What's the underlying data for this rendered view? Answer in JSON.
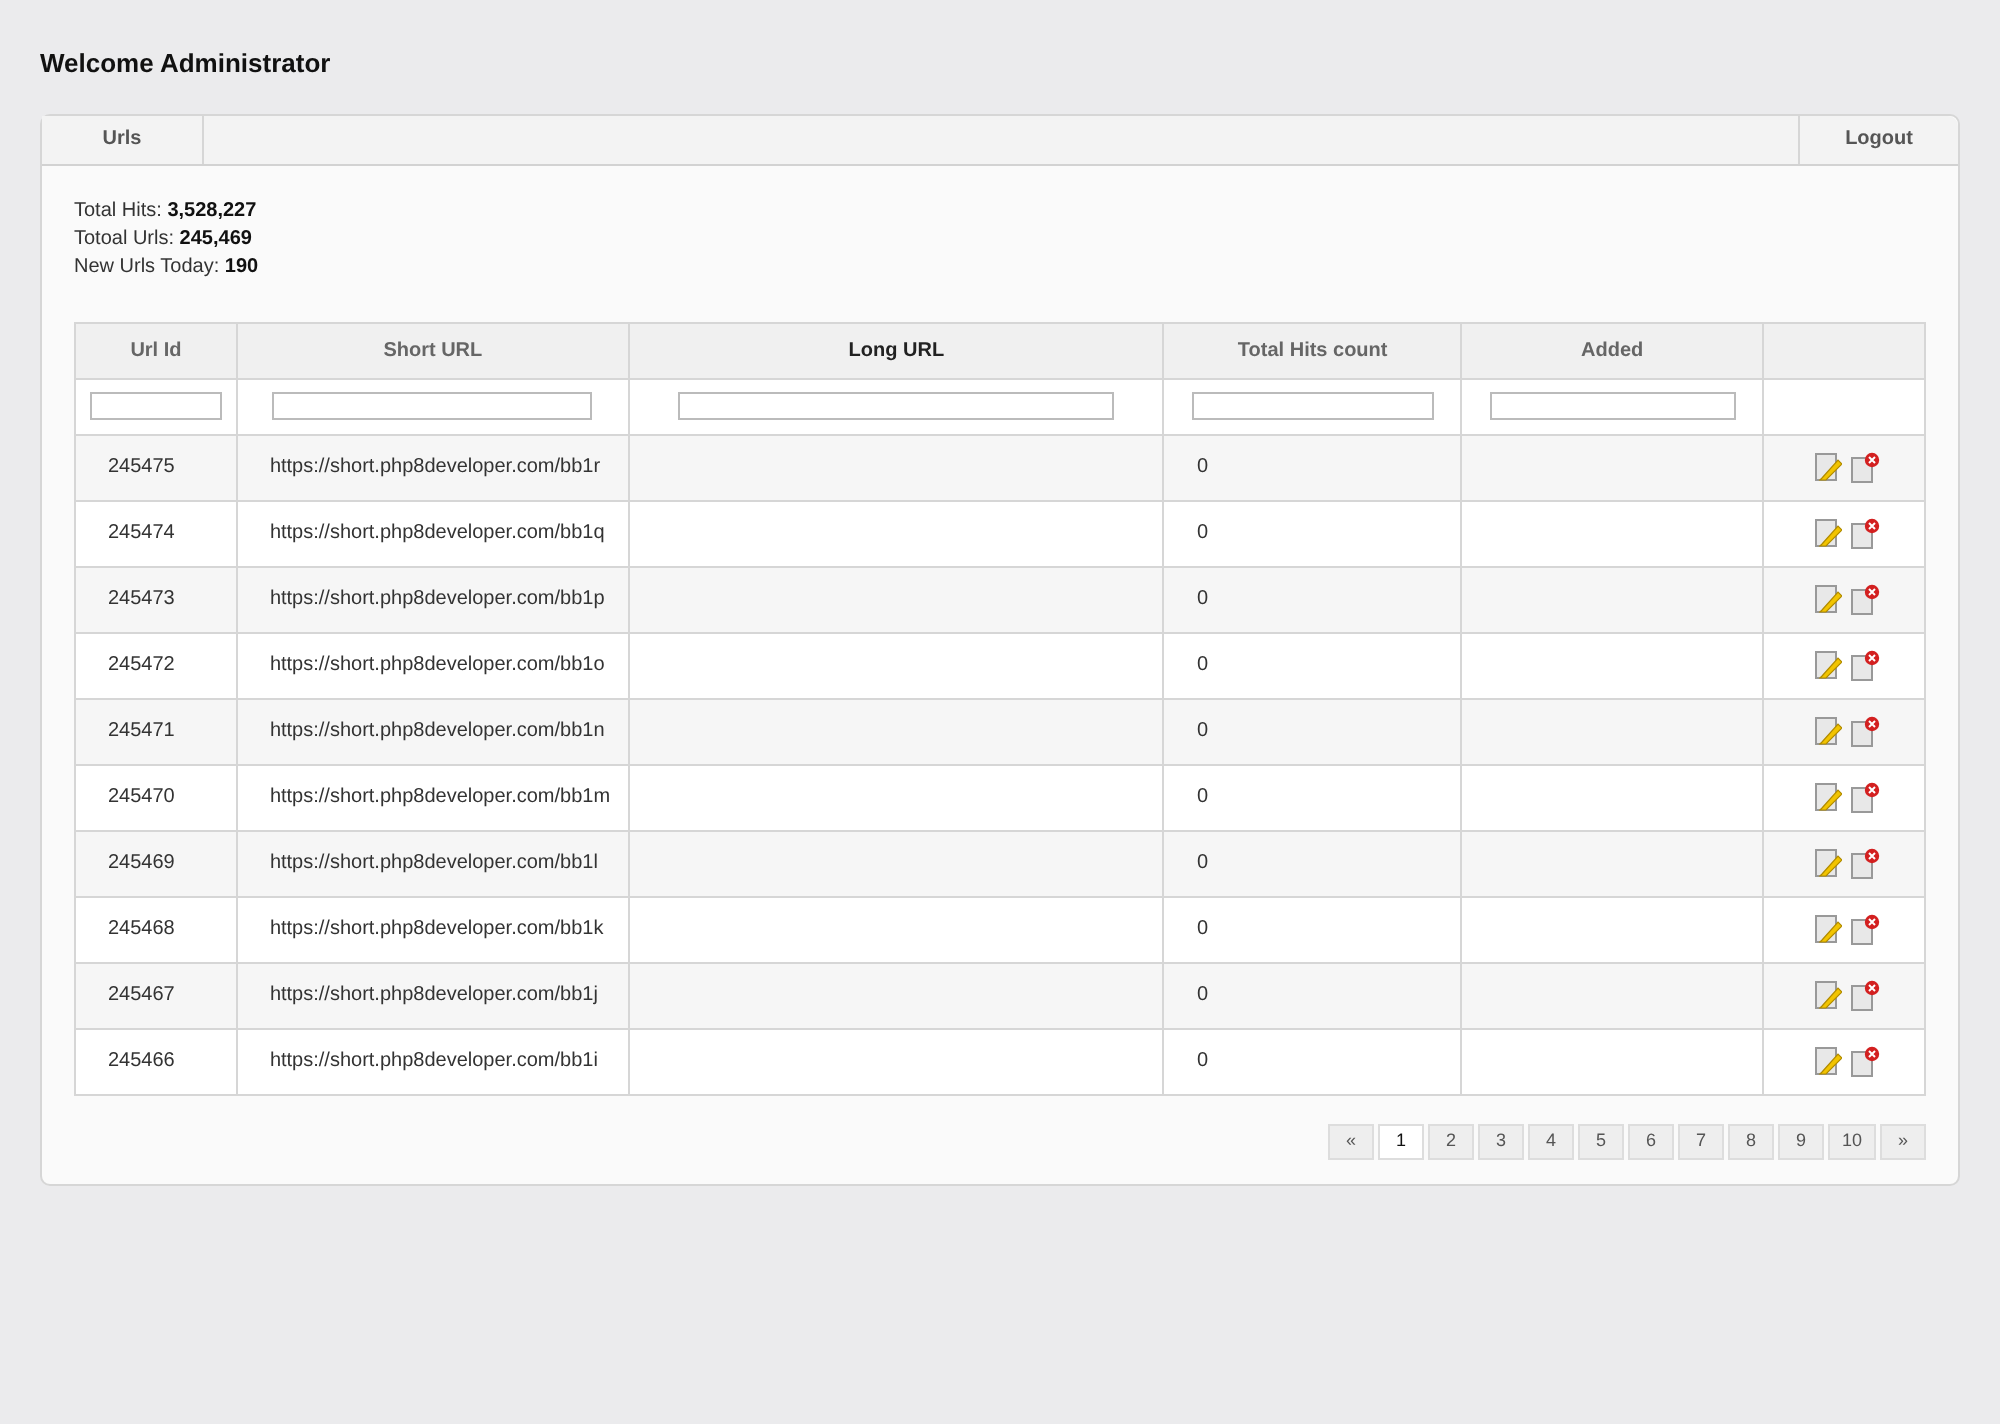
{
  "page_title": "Welcome Administrator",
  "nav": {
    "tabs": [
      {
        "label": "Urls",
        "selected": false
      }
    ],
    "logout": "Logout"
  },
  "stats": [
    {
      "label": "Total Hits:",
      "value": "3,528,227"
    },
    {
      "label": "Totoal Urls:",
      "value": "245,469"
    },
    {
      "label": "New Urls Today:",
      "value": "190"
    }
  ],
  "table": {
    "columns": [
      {
        "label": "Url Id",
        "filter": true,
        "emphasized": false
      },
      {
        "label": "Short URL",
        "filter": true,
        "emphasized": false
      },
      {
        "label": "Long URL",
        "filter": true,
        "emphasized": true
      },
      {
        "label": "Total Hits count",
        "filter": true,
        "emphasized": false
      },
      {
        "label": "Added",
        "filter": true,
        "emphasized": false
      },
      {
        "filter": false
      }
    ],
    "rows": [
      {
        "id": "245475",
        "short_url": "https://short.php8developer.com/bb1r",
        "hits": "0"
      },
      {
        "id": "245474",
        "short_url": "https://short.php8developer.com/bb1q",
        "hits": "0"
      },
      {
        "id": "245473",
        "short_url": "https://short.php8developer.com/bb1p",
        "hits": "0"
      },
      {
        "id": "245472",
        "short_url": "https://short.php8developer.com/bb1o",
        "hits": "0"
      },
      {
        "id": "245471",
        "short_url": "https://short.php8developer.com/bb1n",
        "hits": "0"
      },
      {
        "id": "245470",
        "short_url": "https://short.php8developer.com/bb1m",
        "hits": "0"
      },
      {
        "id": "245469",
        "short_url": "https://short.php8developer.com/bb1l",
        "hits": "0"
      },
      {
        "id": "245468",
        "short_url": "https://short.php8developer.com/bb1k",
        "hits": "0"
      },
      {
        "id": "245467",
        "short_url": "https://short.php8developer.com/bb1j",
        "hits": "0"
      },
      {
        "id": "245466",
        "short_url": "https://short.php8developer.com/bb1i",
        "hits": "0"
      }
    ]
  },
  "pagination": {
    "prev": "«",
    "next": "»",
    "pages": [
      {
        "label": "1",
        "selected": true
      },
      {
        "label": "2",
        "selected": false
      },
      {
        "label": "3",
        "selected": false
      },
      {
        "label": "4",
        "selected": false
      },
      {
        "label": "5",
        "selected": false
      },
      {
        "label": "6",
        "selected": false
      },
      {
        "label": "7",
        "selected": false
      },
      {
        "label": "8",
        "selected": false
      },
      {
        "label": "9",
        "selected": false
      },
      {
        "label": "10",
        "selected": false
      }
    ]
  }
}
